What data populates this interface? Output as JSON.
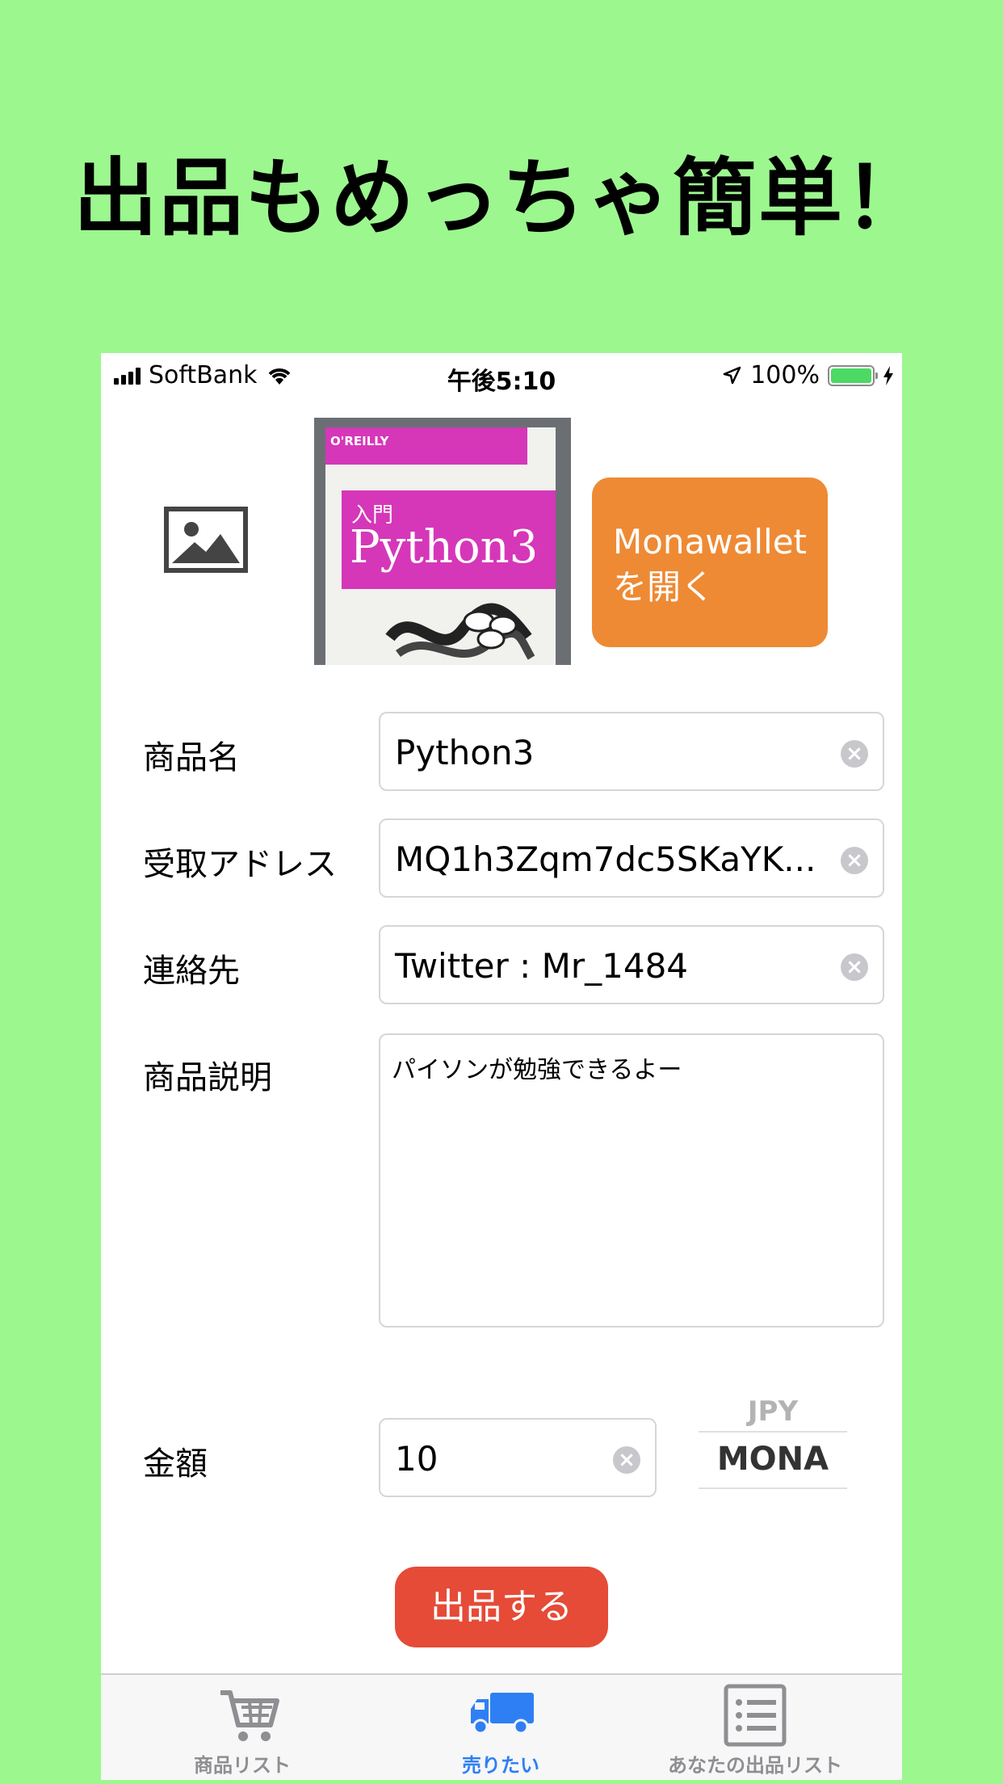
{
  "headline": "出品もめっちゃ簡単！",
  "status_bar": {
    "carrier": "SoftBank",
    "time": "午後5:10",
    "battery_percent": "100%",
    "battery_level": 1.0
  },
  "listing": {
    "image_placeholder": "image-placeholder-icon",
    "photo": {
      "publisher": "O'REILLY",
      "cover_label": "入門",
      "cover_title": "Python3"
    },
    "open_wallet_button": "Monawallet\nを開く"
  },
  "form": {
    "name_label": "商品名",
    "name_value": "Python3",
    "address_label": "受取アドレス",
    "address_value": "MQ1h3Zqm7dc5SKaYK...",
    "contact_label": "連絡先",
    "contact_value": "Twitter : Mr_1484",
    "description_label": "商品説明",
    "description_value": "パイソンが勉強できるよー",
    "price_label": "金額",
    "price_value": "10",
    "currency_options": [
      "JPY",
      "MONA"
    ],
    "currency_selected": "MONA",
    "submit_label": "出品する"
  },
  "tabbar": {
    "items": [
      {
        "label": "商品リスト",
        "icon": "cart-icon",
        "active": false
      },
      {
        "label": "売りたい",
        "icon": "truck-icon",
        "active": true
      },
      {
        "label": "あなたの出品リスト",
        "icon": "list-icon",
        "active": false
      }
    ]
  },
  "colors": {
    "background": "#9cf78f",
    "wallet_button": "#ee8a34",
    "submit_button": "#e54b37",
    "tab_active": "#2f7ff4",
    "tab_inactive": "#8e8e93"
  }
}
